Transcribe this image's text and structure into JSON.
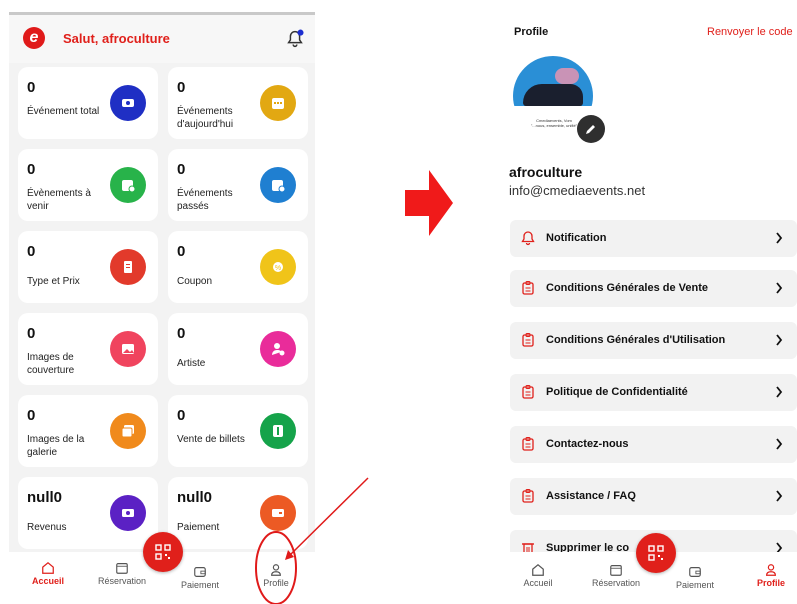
{
  "left": {
    "greeting": "Salut, afroculture",
    "cards": [
      {
        "value": "0",
        "label": "Événement total",
        "color": "#1f2fc4"
      },
      {
        "value": "0",
        "label": "Événements d'aujourd'hui",
        "color": "#e2a812"
      },
      {
        "value": "0",
        "label": "Évènements à venir",
        "color": "#28b34a"
      },
      {
        "value": "0",
        "label": "Événements passés",
        "color": "#1f7fd1"
      },
      {
        "value": "0",
        "label": "Type et Prix",
        "color": "#e23a2b"
      },
      {
        "value": "0",
        "label": "Coupon",
        "color": "#f0c419"
      },
      {
        "value": "0",
        "label": "Images de couverture",
        "color": "#f0445e"
      },
      {
        "value": "0",
        "label": "Artiste",
        "color": "#e92c9a"
      },
      {
        "value": "0",
        "label": "Images de la galerie",
        "color": "#f08a1c"
      },
      {
        "value": "0",
        "label": "Vente de billets",
        "color": "#15a34a"
      },
      {
        "value": "null0",
        "label": "Revenus",
        "color": "#5b21c4"
      },
      {
        "value": "null0",
        "label": "Paiement",
        "color": "#ec5a24"
      }
    ],
    "nav": [
      {
        "label": "Accueil",
        "icon": "home-icon"
      },
      {
        "label": "Réservation",
        "icon": "calendar-icon"
      },
      {
        "label": "Paiement",
        "icon": "wallet-icon"
      },
      {
        "label": "Profile",
        "icon": "user-icon"
      }
    ]
  },
  "right": {
    "title": "Profile",
    "resend": "Renvoyer le code",
    "avatar_caption_1": "Cmediaevents, Vom",
    "avatar_caption_2": "\"...nous, ensemble, unifié\"",
    "name": "afroculture",
    "email": "info@cmediaevents.net",
    "menu": [
      {
        "label": "Notification",
        "icon": "bell-icon"
      },
      {
        "label": "Conditions Générales de Vente",
        "icon": "clipboard-icon"
      },
      {
        "label": "Conditions Générales d'Utilisation",
        "icon": "clipboard-icon"
      },
      {
        "label": "Politique de Confidentialité",
        "icon": "clipboard-icon"
      },
      {
        "label": "Contactez-nous",
        "icon": "clipboard-icon"
      },
      {
        "label": "Assistance / FAQ",
        "icon": "clipboard-icon"
      },
      {
        "label": "Supprimer le co",
        "icon": "trash-icon"
      }
    ],
    "nav": [
      {
        "label": "Accueil",
        "icon": "home-icon"
      },
      {
        "label": "Réservation",
        "icon": "calendar-icon"
      },
      {
        "label": "Paiement",
        "icon": "wallet-icon"
      },
      {
        "label": "Profile",
        "icon": "user-icon"
      }
    ]
  },
  "colors": {
    "accent": "#e0201b",
    "card_bg": "#ffffff",
    "page_bg": "#f3f3f3"
  }
}
